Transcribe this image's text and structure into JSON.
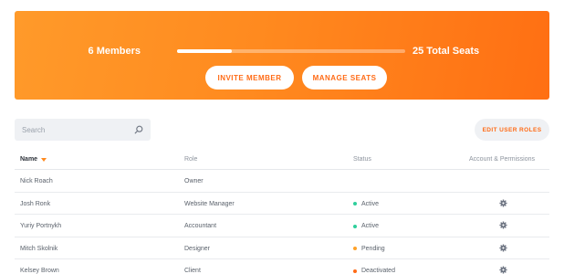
{
  "banner": {
    "members_label": "6 Members",
    "seats_label": "25 Total Seats",
    "progress_fraction": 0.24,
    "invite_button": "INVITE MEMBER",
    "manage_button": "MANAGE SEATS"
  },
  "toolbar": {
    "search_placeholder": "Search",
    "edit_roles_button": "EDIT USER ROLES"
  },
  "table": {
    "headers": {
      "name": "Name",
      "role": "Role",
      "status": "Status",
      "permissions": "Account & Permissions"
    },
    "rows": [
      {
        "name": "Nick Roach",
        "role": "Owner",
        "status": "",
        "status_color": "",
        "has_settings": false
      },
      {
        "name": "Josh Ronk",
        "role": "Website Manager",
        "status": "Active",
        "status_color": "#2fcf9b",
        "has_settings": true
      },
      {
        "name": "Yuriy Portnykh",
        "role": "Accountant",
        "status": "Active",
        "status_color": "#2fcf9b",
        "has_settings": true
      },
      {
        "name": "Mitch Skolnik",
        "role": "Designer",
        "status": "Pending",
        "status_color": "#ffa228",
        "has_settings": true
      },
      {
        "name": "Kelsey Brown",
        "role": "Client",
        "status": "Deactivated",
        "status_color": "#ff6b16",
        "has_settings": true
      }
    ]
  },
  "colors": {
    "accent": "#ff6b16",
    "banner_start": "#ff9a2a",
    "banner_end": "#ff6f13"
  },
  "icons": {
    "search": "search-icon",
    "sort": "sort-down-icon",
    "settings": "gear-icon"
  }
}
